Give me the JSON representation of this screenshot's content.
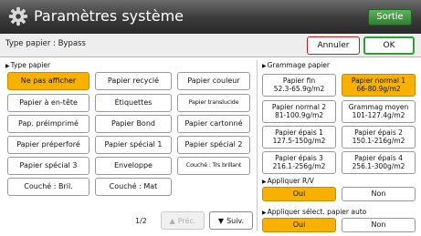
{
  "header": {
    "title": "Paramètres système",
    "exit_label": "Sortie",
    "icon": "gear-icon"
  },
  "subbar": {
    "path": "Type papier : Bypass",
    "cancel_label": "Annuler",
    "ok_label": "OK"
  },
  "paper_type": {
    "section_label": "Type papier",
    "items": [
      {
        "label": "Ne pas afficher",
        "selected": true
      },
      {
        "label": "Papier recyclé",
        "selected": false
      },
      {
        "label": "Papier couleur",
        "selected": false
      },
      {
        "label": "Papier à en-tête",
        "selected": false
      },
      {
        "label": "Étiquettes",
        "selected": false
      },
      {
        "label": "Papier translucide",
        "selected": false
      },
      {
        "label": "Pap. préimprimé",
        "selected": false
      },
      {
        "label": "Papier Bond",
        "selected": false
      },
      {
        "label": "Papier cartonné",
        "selected": false
      },
      {
        "label": "Papier préperforé",
        "selected": false
      },
      {
        "label": "Papier spécial 1",
        "selected": false
      },
      {
        "label": "Papier spécial 2",
        "selected": false
      },
      {
        "label": "Papier spécial 3",
        "selected": false
      },
      {
        "label": "Enveloppe",
        "selected": false
      },
      {
        "label": "Couché : Trs brillant",
        "selected": false
      },
      {
        "label": "Couché : Bril.",
        "selected": false
      },
      {
        "label": "Couché : Mat",
        "selected": false
      }
    ]
  },
  "pagination": {
    "page": "1/2",
    "prev_label": "Préc.",
    "next_label": "Suiv."
  },
  "weight": {
    "section_label": "Grammage papier",
    "items": [
      {
        "line1": "Papier fin",
        "line2": "52.3-65.9g/m2",
        "selected": false
      },
      {
        "line1": "Papier normal 1",
        "line2": "66-80.9g/m2",
        "selected": true
      },
      {
        "line1": "Papier normal 2",
        "line2": "81-100.9g/m2",
        "selected": false
      },
      {
        "line1": "Grammag moyen",
        "line2": "101-127.4g/m2",
        "selected": false
      },
      {
        "line1": "Papier épais 1",
        "line2": "127.5-150g/m2",
        "selected": false
      },
      {
        "line1": "Papier épais 2",
        "line2": "150.1-216g/m2",
        "selected": false
      },
      {
        "line1": "Papier épais 3",
        "line2": "216.1-256g/m2",
        "selected": false
      },
      {
        "line1": "Papier épais 4",
        "line2": "256.1-300g/m2",
        "selected": false
      }
    ]
  },
  "duplex": {
    "section_label": "Appliquer R/V",
    "yes_label": "Oui",
    "no_label": "Non",
    "yes_selected": true
  },
  "auto_select": {
    "section_label": "Appliquer sélect. papier auto",
    "yes_label": "Oui",
    "no_label": "Non",
    "yes_selected": true
  },
  "colors": {
    "selected": "#f9b100",
    "exit_green": "#3f8f3f",
    "ok_border": "#2f9f2f",
    "cancel_border": "#c02020"
  }
}
